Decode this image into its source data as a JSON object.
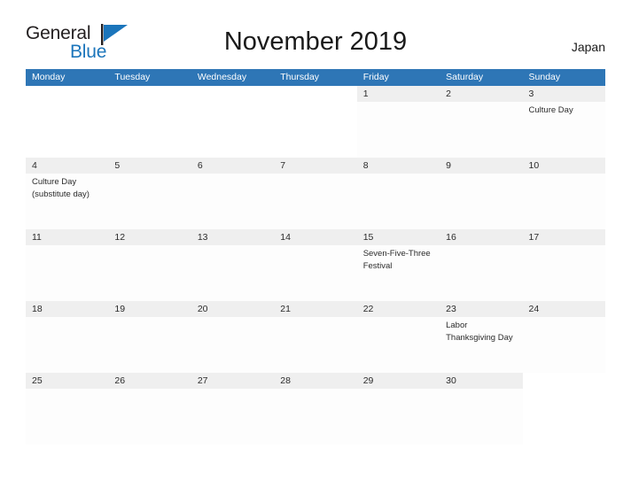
{
  "brand": {
    "name_part1": "General",
    "name_part2": "Blue",
    "flag_icon": "blue-triangle-flag"
  },
  "header": {
    "title": "November 2019",
    "region": "Japan"
  },
  "colors": {
    "header_blue": "#2e76b6",
    "brand_blue": "#1b75bb",
    "day_bar_gray": "#efefef",
    "rule_blue": "#2e76b6",
    "text_dark": "#2b2b2b"
  },
  "calendar": {
    "weekdays": [
      "Monday",
      "Tuesday",
      "Wednesday",
      "Thursday",
      "Friday",
      "Saturday",
      "Sunday"
    ],
    "weeks": [
      [
        {
          "day": "",
          "events": ""
        },
        {
          "day": "",
          "events": ""
        },
        {
          "day": "",
          "events": ""
        },
        {
          "day": "",
          "events": ""
        },
        {
          "day": "1",
          "events": ""
        },
        {
          "day": "2",
          "events": ""
        },
        {
          "day": "3",
          "events": "Culture Day"
        }
      ],
      [
        {
          "day": "4",
          "events": "Culture Day\n(substitute day)"
        },
        {
          "day": "5",
          "events": ""
        },
        {
          "day": "6",
          "events": ""
        },
        {
          "day": "7",
          "events": ""
        },
        {
          "day": "8",
          "events": ""
        },
        {
          "day": "9",
          "events": ""
        },
        {
          "day": "10",
          "events": ""
        }
      ],
      [
        {
          "day": "11",
          "events": ""
        },
        {
          "day": "12",
          "events": ""
        },
        {
          "day": "13",
          "events": ""
        },
        {
          "day": "14",
          "events": ""
        },
        {
          "day": "15",
          "events": "Seven-Five-Three\nFestival"
        },
        {
          "day": "16",
          "events": ""
        },
        {
          "day": "17",
          "events": ""
        }
      ],
      [
        {
          "day": "18",
          "events": ""
        },
        {
          "day": "19",
          "events": ""
        },
        {
          "day": "20",
          "events": ""
        },
        {
          "day": "21",
          "events": ""
        },
        {
          "day": "22",
          "events": ""
        },
        {
          "day": "23",
          "events": "Labor\nThanksgiving Day"
        },
        {
          "day": "24",
          "events": ""
        }
      ],
      [
        {
          "day": "25",
          "events": ""
        },
        {
          "day": "26",
          "events": ""
        },
        {
          "day": "27",
          "events": ""
        },
        {
          "day": "28",
          "events": ""
        },
        {
          "day": "29",
          "events": ""
        },
        {
          "day": "30",
          "events": ""
        },
        {
          "day": "",
          "events": ""
        }
      ]
    ]
  }
}
